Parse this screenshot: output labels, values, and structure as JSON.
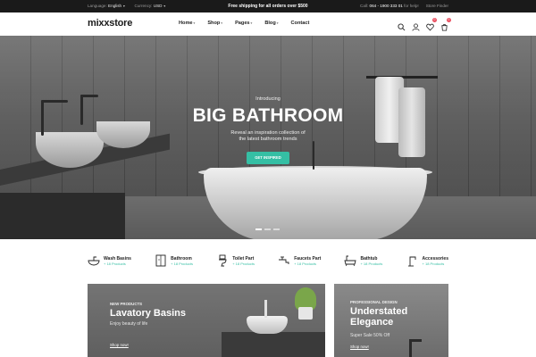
{
  "topbar": {
    "language_label": "Language:",
    "language_value": "English",
    "currency_label": "Currency:",
    "currency_value": "USD",
    "promo": "Free shipping for all orders over $500",
    "call_label": "Call:",
    "phone": "064 - 1900 333 01",
    "help_suffix": "for help!",
    "store_finder": "Store Finder"
  },
  "header": {
    "logo": "mixxstore",
    "nav": [
      {
        "label": "Home",
        "has_dropdown": true
      },
      {
        "label": "Shop",
        "has_dropdown": true
      },
      {
        "label": "Pages",
        "has_dropdown": true
      },
      {
        "label": "Blog",
        "has_dropdown": true
      },
      {
        "label": "Contact",
        "has_dropdown": false
      }
    ],
    "icons": [
      "search-icon",
      "user-icon",
      "heart-icon",
      "cart-icon"
    ],
    "wishlist_count": "0",
    "cart_count": "0"
  },
  "hero": {
    "intro": "Introducing",
    "title": "BIG BATHROOM",
    "subtitle_line1": "Reveal an inspiration collection of",
    "subtitle_line2": "the latest bathroom trends",
    "cta": "GET INSPIRED",
    "slides": 3,
    "active_slide": 1
  },
  "categories": [
    {
      "name": "Wash Basins",
      "count": "+ 18 Products",
      "icon": "basin-icon"
    },
    {
      "name": "Bathroom",
      "count": "+ 18 Products",
      "icon": "shower-icon"
    },
    {
      "name": "Toilet Part",
      "count": "+ 18 Products",
      "icon": "toilet-icon"
    },
    {
      "name": "Faucets Part",
      "count": "+ 18 Products",
      "icon": "faucet-icon"
    },
    {
      "name": "Bathtub",
      "count": "+ 18 Products",
      "icon": "bathtub-icon"
    },
    {
      "name": "Accessories",
      "count": "+ 18 Products",
      "icon": "tap-icon"
    }
  ],
  "banners": {
    "left": {
      "eyebrow": "NEW PRODUCTS",
      "title": "Lavatory Basins",
      "subtitle": "Enjoy beauty of life",
      "link": "Shop now!"
    },
    "right": {
      "eyebrow": "PROFESSIONAL DESIGN",
      "title_line1": "Understated",
      "title_line2": "Elegance",
      "subtitle": "Super Sale 50% Off",
      "link": "Shop now!"
    }
  },
  "colors": {
    "accent": "#35bfa4",
    "topbar_bg": "#1a1a1a",
    "badge": "#e94e5f"
  }
}
